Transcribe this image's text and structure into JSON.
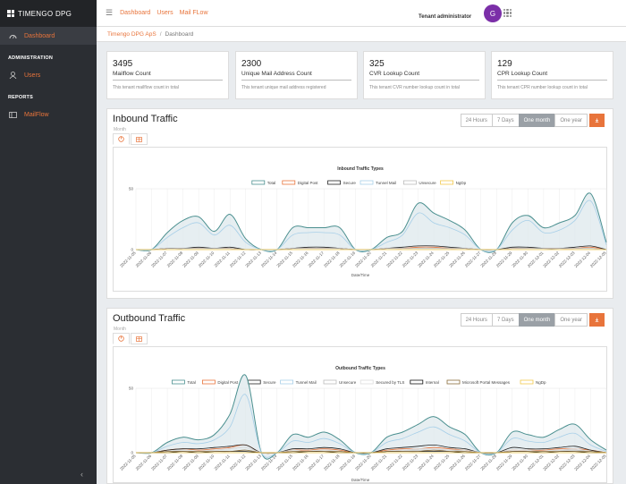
{
  "app": {
    "title": "TIMENGO DPG",
    "tenant": "Tenant administrator",
    "avatar": "G"
  },
  "sidebar": {
    "dashboard": "Dashboard",
    "admin_section": "ADMINISTRATION",
    "users": "Users",
    "reports_section": "REPORTS",
    "mailflow": "MailFlow",
    "collapse": "‹"
  },
  "topnav": {
    "dashboard": "Dashboard",
    "users": "Users",
    "mailflow": "Mail FLow"
  },
  "breadcrumb": {
    "org": "Timengo DPG ApS",
    "sep": "/",
    "page": "Dashboard"
  },
  "stats": [
    {
      "value": "3495",
      "label": "Mailflow Count",
      "desc": "This tenant mailflow count in total"
    },
    {
      "value": "2300",
      "label": "Unique Mail Address Count",
      "desc": "This tenant unique mail address registered"
    },
    {
      "value": "325",
      "label": "CVR Lookup Count",
      "desc": "This tenant CVR number lookup count in total"
    },
    {
      "value": "129",
      "label": "CPR Lookup Count",
      "desc": "This tenant CPR number lookup count in total"
    }
  ],
  "ranges": [
    "24 Hours",
    "7 Days",
    "One month",
    "One year"
  ],
  "selected_range": "One month",
  "colors": {
    "accent": "#e8743b",
    "sidebar": "#2b2e33",
    "total": "#4a8f8f"
  },
  "dates": [
    "2022-11-05",
    "2022-11-06",
    "2022-11-07",
    "2022-11-08",
    "2022-11-09",
    "2022-11-10",
    "2022-11-11",
    "2022-11-12",
    "2022-11-13",
    "2022-11-14",
    "2022-11-15",
    "2022-11-16",
    "2022-11-17",
    "2022-11-18",
    "2022-11-19",
    "2022-11-20",
    "2022-11-21",
    "2022-11-22",
    "2022-11-23",
    "2022-11-24",
    "2022-11-25",
    "2022-11-26",
    "2022-11-27",
    "2022-11-28",
    "2022-11-29",
    "2022-11-30",
    "2022-12-01",
    "2022-12-02",
    "2022-12-03",
    "2022-12-04",
    "2022-12-05"
  ],
  "inbound": {
    "title": "Inbound Traffic",
    "subtitle": "Month",
    "chart_data": {
      "type": "area",
      "title": "Inbound Traffic Types",
      "xlabel": "Date/Time",
      "ylim": [
        0,
        50
      ],
      "series": [
        {
          "name": "Total",
          "color": "#4a8f8f",
          "values": [
            0,
            0,
            14,
            24,
            27,
            15,
            29,
            9,
            0,
            0,
            18,
            18,
            18,
            18,
            0,
            0,
            10,
            15,
            38,
            30,
            24,
            16,
            0,
            0,
            22,
            28,
            18,
            22,
            28,
            46,
            6
          ]
        },
        {
          "name": "Digital Post",
          "color": "#e8743b",
          "values": [
            0,
            0,
            1,
            1,
            1,
            1,
            1,
            0,
            0,
            0,
            1,
            1,
            1,
            1,
            0,
            0,
            1,
            1,
            2,
            2,
            1,
            1,
            0,
            0,
            1,
            1,
            1,
            1,
            1,
            2,
            0
          ]
        },
        {
          "name": "Secure",
          "color": "#222222",
          "values": [
            0,
            0,
            1,
            1,
            2,
            1,
            2,
            0,
            0,
            0,
            1,
            2,
            2,
            1,
            0,
            0,
            1,
            2,
            3,
            3,
            2,
            1,
            0,
            0,
            2,
            2,
            1,
            1,
            2,
            3,
            0
          ]
        },
        {
          "name": "Tunnel Mail",
          "color": "#a7cfe8",
          "values": [
            0,
            0,
            10,
            18,
            22,
            12,
            20,
            6,
            0,
            0,
            12,
            14,
            14,
            12,
            0,
            0,
            6,
            12,
            30,
            22,
            18,
            12,
            0,
            0,
            16,
            24,
            14,
            16,
            24,
            40,
            4
          ]
        },
        {
          "name": "Unsecure",
          "color": "#bbbbbb",
          "values": [
            0,
            0,
            1,
            1,
            1,
            1,
            1,
            0,
            0,
            0,
            1,
            1,
            1,
            1,
            0,
            0,
            1,
            1,
            1,
            1,
            1,
            1,
            0,
            0,
            1,
            1,
            1,
            1,
            1,
            1,
            0
          ]
        },
        {
          "name": "NgDp",
          "color": "#f2c94c",
          "values": [
            0,
            0,
            0,
            0,
            0,
            0,
            0,
            0,
            0,
            0,
            0,
            0,
            0,
            0,
            0,
            0,
            0,
            0,
            0,
            0,
            0,
            0,
            0,
            0,
            0,
            0,
            0,
            0,
            0,
            0,
            0
          ]
        }
      ]
    }
  },
  "outbound": {
    "title": "Outbound Traffic",
    "subtitle": "Month",
    "chart_data": {
      "type": "area",
      "title": "Outbound Traffic Types",
      "xlabel": "Date/Time",
      "ylim": [
        0,
        50
      ],
      "series": [
        {
          "name": "Total",
          "color": "#4a8f8f",
          "values": [
            0,
            0,
            8,
            12,
            10,
            14,
            30,
            60,
            0,
            0,
            14,
            12,
            16,
            10,
            0,
            0,
            12,
            16,
            22,
            28,
            20,
            14,
            0,
            0,
            16,
            14,
            12,
            18,
            22,
            10,
            2
          ]
        },
        {
          "name": "Digital Post",
          "color": "#e8743b",
          "values": [
            0,
            0,
            2,
            3,
            2,
            3,
            4,
            6,
            0,
            0,
            2,
            2,
            3,
            2,
            0,
            0,
            2,
            3,
            3,
            4,
            3,
            2,
            0,
            0,
            2,
            2,
            2,
            3,
            3,
            2,
            0
          ]
        },
        {
          "name": "Secure",
          "color": "#222222",
          "values": [
            0,
            0,
            2,
            3,
            3,
            4,
            5,
            6,
            0,
            0,
            3,
            3,
            4,
            3,
            0,
            0,
            3,
            4,
            5,
            6,
            4,
            3,
            0,
            0,
            4,
            3,
            3,
            4,
            5,
            2,
            0
          ]
        },
        {
          "name": "Tunnel Mail",
          "color": "#a7cfe8",
          "values": [
            0,
            0,
            5,
            8,
            7,
            10,
            20,
            45,
            0,
            0,
            9,
            8,
            11,
            7,
            0,
            0,
            8,
            11,
            16,
            20,
            14,
            9,
            0,
            0,
            11,
            9,
            8,
            12,
            15,
            6,
            1
          ]
        },
        {
          "name": "Unsecure",
          "color": "#bbbbbb",
          "values": [
            0,
            0,
            1,
            1,
            1,
            2,
            3,
            4,
            0,
            0,
            1,
            1,
            2,
            1,
            0,
            0,
            1,
            2,
            2,
            2,
            2,
            1,
            0,
            0,
            1,
            1,
            1,
            2,
            2,
            1,
            0
          ]
        },
        {
          "name": "Secured by TLS",
          "color": "#dddddd",
          "values": [
            0,
            0,
            1,
            2,
            1,
            2,
            3,
            4,
            0,
            0,
            2,
            1,
            2,
            1,
            0,
            0,
            1,
            2,
            3,
            3,
            2,
            2,
            0,
            0,
            2,
            2,
            1,
            2,
            3,
            1,
            0
          ]
        },
        {
          "name": "Internal",
          "color": "#111111",
          "values": [
            0,
            0,
            0,
            1,
            0,
            1,
            1,
            1,
            0,
            0,
            0,
            1,
            1,
            0,
            0,
            0,
            1,
            1,
            1,
            1,
            1,
            0,
            0,
            0,
            1,
            1,
            0,
            1,
            1,
            0,
            0
          ]
        },
        {
          "name": "Microsoft Portal Messages",
          "color": "#8a6d3b",
          "values": [
            0,
            0,
            1,
            1,
            1,
            1,
            1,
            2,
            0,
            0,
            1,
            1,
            1,
            1,
            0,
            0,
            1,
            1,
            1,
            2,
            1,
            1,
            0,
            0,
            1,
            1,
            1,
            1,
            1,
            1,
            0
          ]
        },
        {
          "name": "NgDp",
          "color": "#f2c94c",
          "values": [
            0,
            0,
            0,
            0,
            0,
            0,
            0,
            0,
            0,
            0,
            0,
            0,
            0,
            0,
            0,
            0,
            0,
            0,
            0,
            0,
            0,
            0,
            0,
            0,
            0,
            0,
            0,
            0,
            0,
            0,
            0
          ]
        }
      ]
    }
  }
}
